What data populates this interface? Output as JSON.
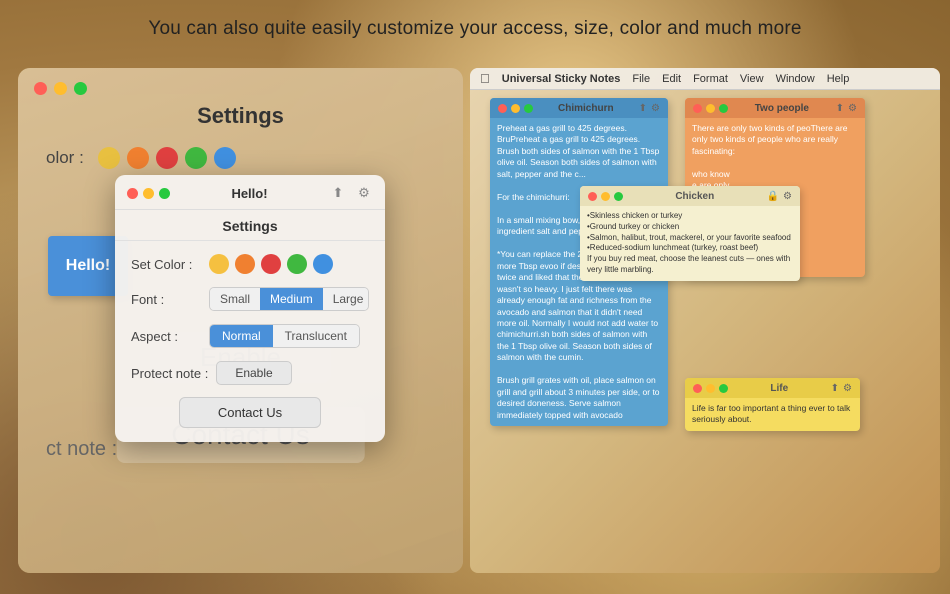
{
  "header": {
    "text": "You can also quite easily customize your access, size, color and much more"
  },
  "left_panel": {
    "title": "Settings",
    "hello_note": "Hello!",
    "color_label": "olor :",
    "contact_us_big": "Contact Us",
    "enable_big": "Enable",
    "protect_label": "ct note :",
    "color_dots": [
      "#e8c040",
      "#f08030",
      "#e04040",
      "#40b840",
      "#4090e0"
    ]
  },
  "settings_modal": {
    "title": "Settings",
    "hello_title": "Hello!",
    "set_color_label": "Set Color :",
    "font_label": "Font :",
    "aspect_label": "Aspect :",
    "protect_label": "Protect note :",
    "font_options": [
      "Small",
      "Medium",
      "Large"
    ],
    "font_active": "Medium",
    "aspect_options": [
      "Normal",
      "Translucent"
    ],
    "aspect_active": "Normal",
    "enable_btn": "Enable",
    "contact_btn": "Contact Us",
    "colors": [
      "#f5c040",
      "#f08030",
      "#e04040",
      "#40b840",
      "#4090e0"
    ]
  },
  "right_panel": {
    "app_name": "Universal Sticky Notes",
    "menu_items": [
      "File",
      "Edit",
      "Format",
      "View",
      "Window",
      "Help"
    ],
    "notes": [
      {
        "id": "chimichurri",
        "title": "Chimichurn",
        "color": "#5ba3d0",
        "header_color": "#4a8fc0",
        "body": "Preheat a gas grill to 425 degrees. BruPreheat a gas grill to 425 degrees. Brush both sides of salmon with the 1 Tbsp olive oil. Season both sides of salmon with salt, pepper and the c..."
      },
      {
        "id": "two-people",
        "title": "Two people",
        "color": "#f0a060",
        "header_color": "#e08850",
        "body": "There are only two kinds of peoThere are only two kinds of people who are really fascinating:"
      },
      {
        "id": "chicken",
        "title": "Chicken",
        "color": "#f5f0d0",
        "header_color": "#e8e0b8",
        "body": "•Skinless chicken or turkey\n•Ground turkey or chicken\n•Salmon, halibut, trout, mackerel, or your favorite seafood\n•Reduced-sodium lunchmeat (turkey, roast beef)\nIf you buy red meat, choose the leanest cuts — ones with very little marbling."
      },
      {
        "id": "life",
        "title": "Life",
        "color": "#f5dc60",
        "header_color": "#e8cc48",
        "body": "Life is far too important a thing ever to talk seriously about."
      }
    ]
  },
  "icons": {
    "share": "⬆",
    "gear": "⚙",
    "lock": "🔒"
  }
}
